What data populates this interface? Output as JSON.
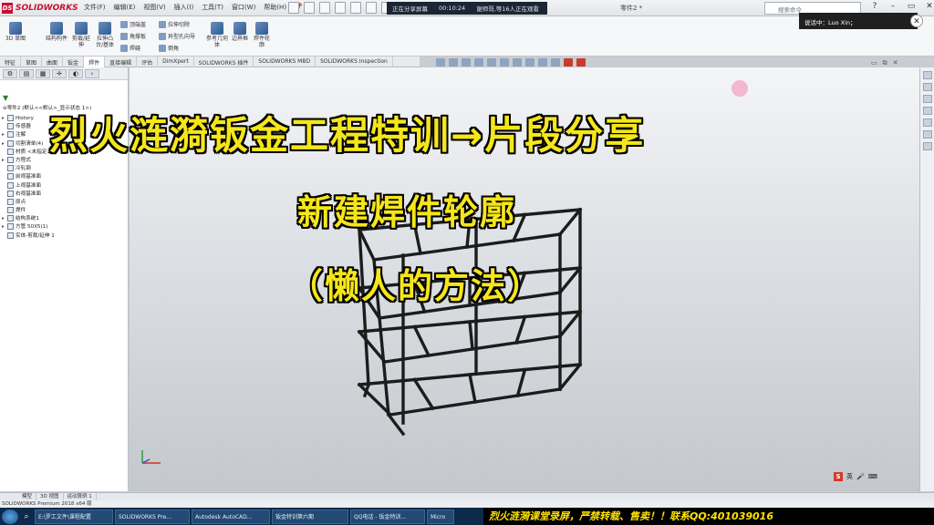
{
  "app": {
    "name": "SOLIDWORKS",
    "menus": [
      "文件(F)",
      "编辑(E)",
      "视图(V)",
      "插入(I)",
      "工具(T)",
      "窗口(W)",
      "帮助(H)"
    ],
    "doc_title": "零件2 *",
    "search_placeholder": "搜索命令"
  },
  "share": {
    "status": "正在分享屏幕",
    "time": "00:10:24",
    "viewers": "谢师哥,等16人正在观看"
  },
  "speaker": {
    "text": "说话中：Luo Xin；"
  },
  "command_manager": {
    "large": [
      {
        "label": "3D 草图",
        "icon": "sketch-3d-icon"
      },
      {
        "label": "结构构件",
        "icon": "structural-member-icon"
      },
      {
        "label": "剪裁/延伸",
        "icon": "trim-extend-icon"
      },
      {
        "label": "拉伸凸台/基体",
        "icon": "extrude-boss-icon"
      }
    ],
    "small": [
      {
        "label": "顶端盖",
        "icon": "end-cap-icon"
      },
      {
        "label": "角撑板",
        "icon": "gusset-icon"
      },
      {
        "label": "焊缝",
        "icon": "weld-bead-icon"
      },
      {
        "label": "拉伸切除",
        "icon": "extrude-cut-icon"
      },
      {
        "label": "异型孔向导",
        "icon": "hole-wizard-icon"
      },
      {
        "label": "倒角",
        "icon": "chamfer-icon"
      }
    ],
    "right": [
      {
        "label": "参考几何体",
        "icon": "ref-geometry-icon"
      },
      {
        "label": "边界框",
        "icon": "bounding-box-icon"
      },
      {
        "label": "焊件轮廓",
        "icon": "weldment-profile-icon"
      }
    ]
  },
  "tabs": [
    "特征",
    "草图",
    "曲面",
    "钣金",
    "焊件",
    "直接编辑",
    "评估",
    "DimXpert",
    "SOLIDWORKS 插件",
    "SOLIDWORKS MBD",
    "SOLIDWORKS Inspection"
  ],
  "active_tab": "焊件",
  "tree": {
    "root": "零件2 (默认<<默认>_显示状态 1>)",
    "items": [
      {
        "label": "History",
        "expand": "▸"
      },
      {
        "label": "传感器",
        "expand": ""
      },
      {
        "label": "注解",
        "expand": "▸"
      },
      {
        "label": "切割清单(4)",
        "expand": "▸"
      },
      {
        "label": "材质 <未指定>",
        "expand": ""
      },
      {
        "label": "方程式",
        "expand": "▸"
      },
      {
        "label": "冷轧钢",
        "expand": ""
      },
      {
        "label": "前视基准面",
        "expand": ""
      },
      {
        "label": "上视基准面",
        "expand": ""
      },
      {
        "label": "右视基准面",
        "expand": ""
      },
      {
        "label": "原点",
        "expand": ""
      },
      {
        "label": "焊件",
        "expand": ""
      },
      {
        "label": "结构系统1",
        "expand": "▸"
      },
      {
        "label": "方管 50X5(1)",
        "expand": "▸"
      },
      {
        "label": "实体-剪裁/延伸 1",
        "expand": ""
      }
    ]
  },
  "overlay": {
    "line1": "烈火涟漪钣金工程特训→片段分享",
    "line2": "新建焊件轮廓",
    "line3": "（懒人的方法）"
  },
  "bottom_tabs": [
    "模型",
    "3D 视图",
    "运动算例 1"
  ],
  "status": "SOLIDWORKS Premium 2018 x64 版",
  "ime": {
    "label": "英"
  },
  "taskbar": [
    {
      "label": "E:\\罗工文件\\课程配置",
      "icon": "folder-icon"
    },
    {
      "label": "SOLIDWORKS Pre...",
      "icon": "solidworks-icon"
    },
    {
      "label": "Autodesk AutoCAD...",
      "icon": "autocad-icon"
    },
    {
      "label": "钣金特训第六期",
      "icon": "chat-icon"
    },
    {
      "label": "QQ电话 - 钣金特训...",
      "icon": "qq-icon"
    },
    {
      "label": "Micro",
      "icon": "word-icon"
    }
  ],
  "banner": "烈火涟漪课堂录屏，严禁转载、售卖！！联系QQ:401039016",
  "colors": {
    "overlay_text": "#f5e61a",
    "banner_text": "#ffe400",
    "brand": "#c8102e"
  }
}
